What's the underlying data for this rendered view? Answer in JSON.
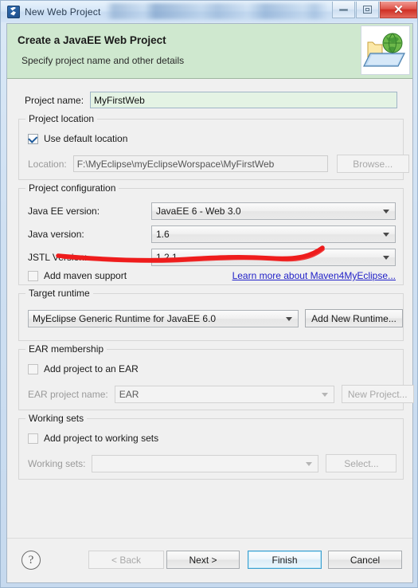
{
  "window": {
    "title": "New Web Project",
    "icon": "myeclipse-icon",
    "controls": {
      "minimize": "minimize",
      "restore": "restore",
      "close": "close"
    }
  },
  "banner": {
    "title": "Create a JavaEE Web Project",
    "subtitle": "Specify project name and other details",
    "icon": "web-folder-globe-icon",
    "background_color": "#cfe8cf"
  },
  "form": {
    "project_name": {
      "label": "Project name:",
      "value": "MyFirstWeb",
      "placeholder": "",
      "focused": true,
      "field_background": "#e4f3e4"
    },
    "project_location": {
      "legend": "Project location",
      "use_default": {
        "label": "Use default location",
        "checked": true
      },
      "location": {
        "label": "Location:",
        "value": "F:\\MyEclipse\\myEclipseWorspace\\MyFirstWeb",
        "disabled": true
      },
      "browse_button": {
        "label": "Browse...",
        "disabled": true
      }
    },
    "project_configuration": {
      "legend": "Project configuration",
      "java_ee_version": {
        "label": "Java EE version:",
        "value": "JavaEE 6 - Web 3.0"
      },
      "java_version": {
        "label": "Java version:",
        "value": "1.6"
      },
      "jstl_version": {
        "label": "JSTL Version:",
        "value": "1.2.1"
      },
      "add_maven": {
        "label": "Add maven support",
        "checked": false
      },
      "maven_link": "Learn more about Maven4MyEclipse...",
      "link_color": "#2222c8"
    },
    "target_runtime": {
      "legend": "Target runtime",
      "value": "MyEclipse Generic Runtime for JavaEE 6.0",
      "add_runtime_button": "Add New Runtime..."
    },
    "ear_membership": {
      "legend": "EAR membership",
      "add_to_ear": {
        "label": "Add project to an EAR",
        "checked": false
      },
      "ear_project_name": {
        "label": "EAR project name:",
        "value": "EAR",
        "disabled": true
      },
      "new_project_button": {
        "label": "New Project...",
        "disabled": true
      }
    },
    "working_sets": {
      "legend": "Working sets",
      "add_to_working_sets": {
        "label": "Add project to working sets",
        "checked": false
      },
      "working_sets_field": {
        "label": "Working sets:",
        "value": "",
        "disabled": true
      },
      "select_button": {
        "label": "Select...",
        "disabled": true
      }
    }
  },
  "footer": {
    "help_icon": "?",
    "back_button": {
      "label": "< Back",
      "disabled": true
    },
    "next_button": {
      "label": "Next >",
      "disabled": false
    },
    "finish_button": {
      "label": "Finish",
      "default": true
    },
    "cancel_button": {
      "label": "Cancel"
    }
  },
  "annotation": {
    "type": "red-handdrawn-underline",
    "color": "#ee1c1c",
    "target": "location-field"
  }
}
